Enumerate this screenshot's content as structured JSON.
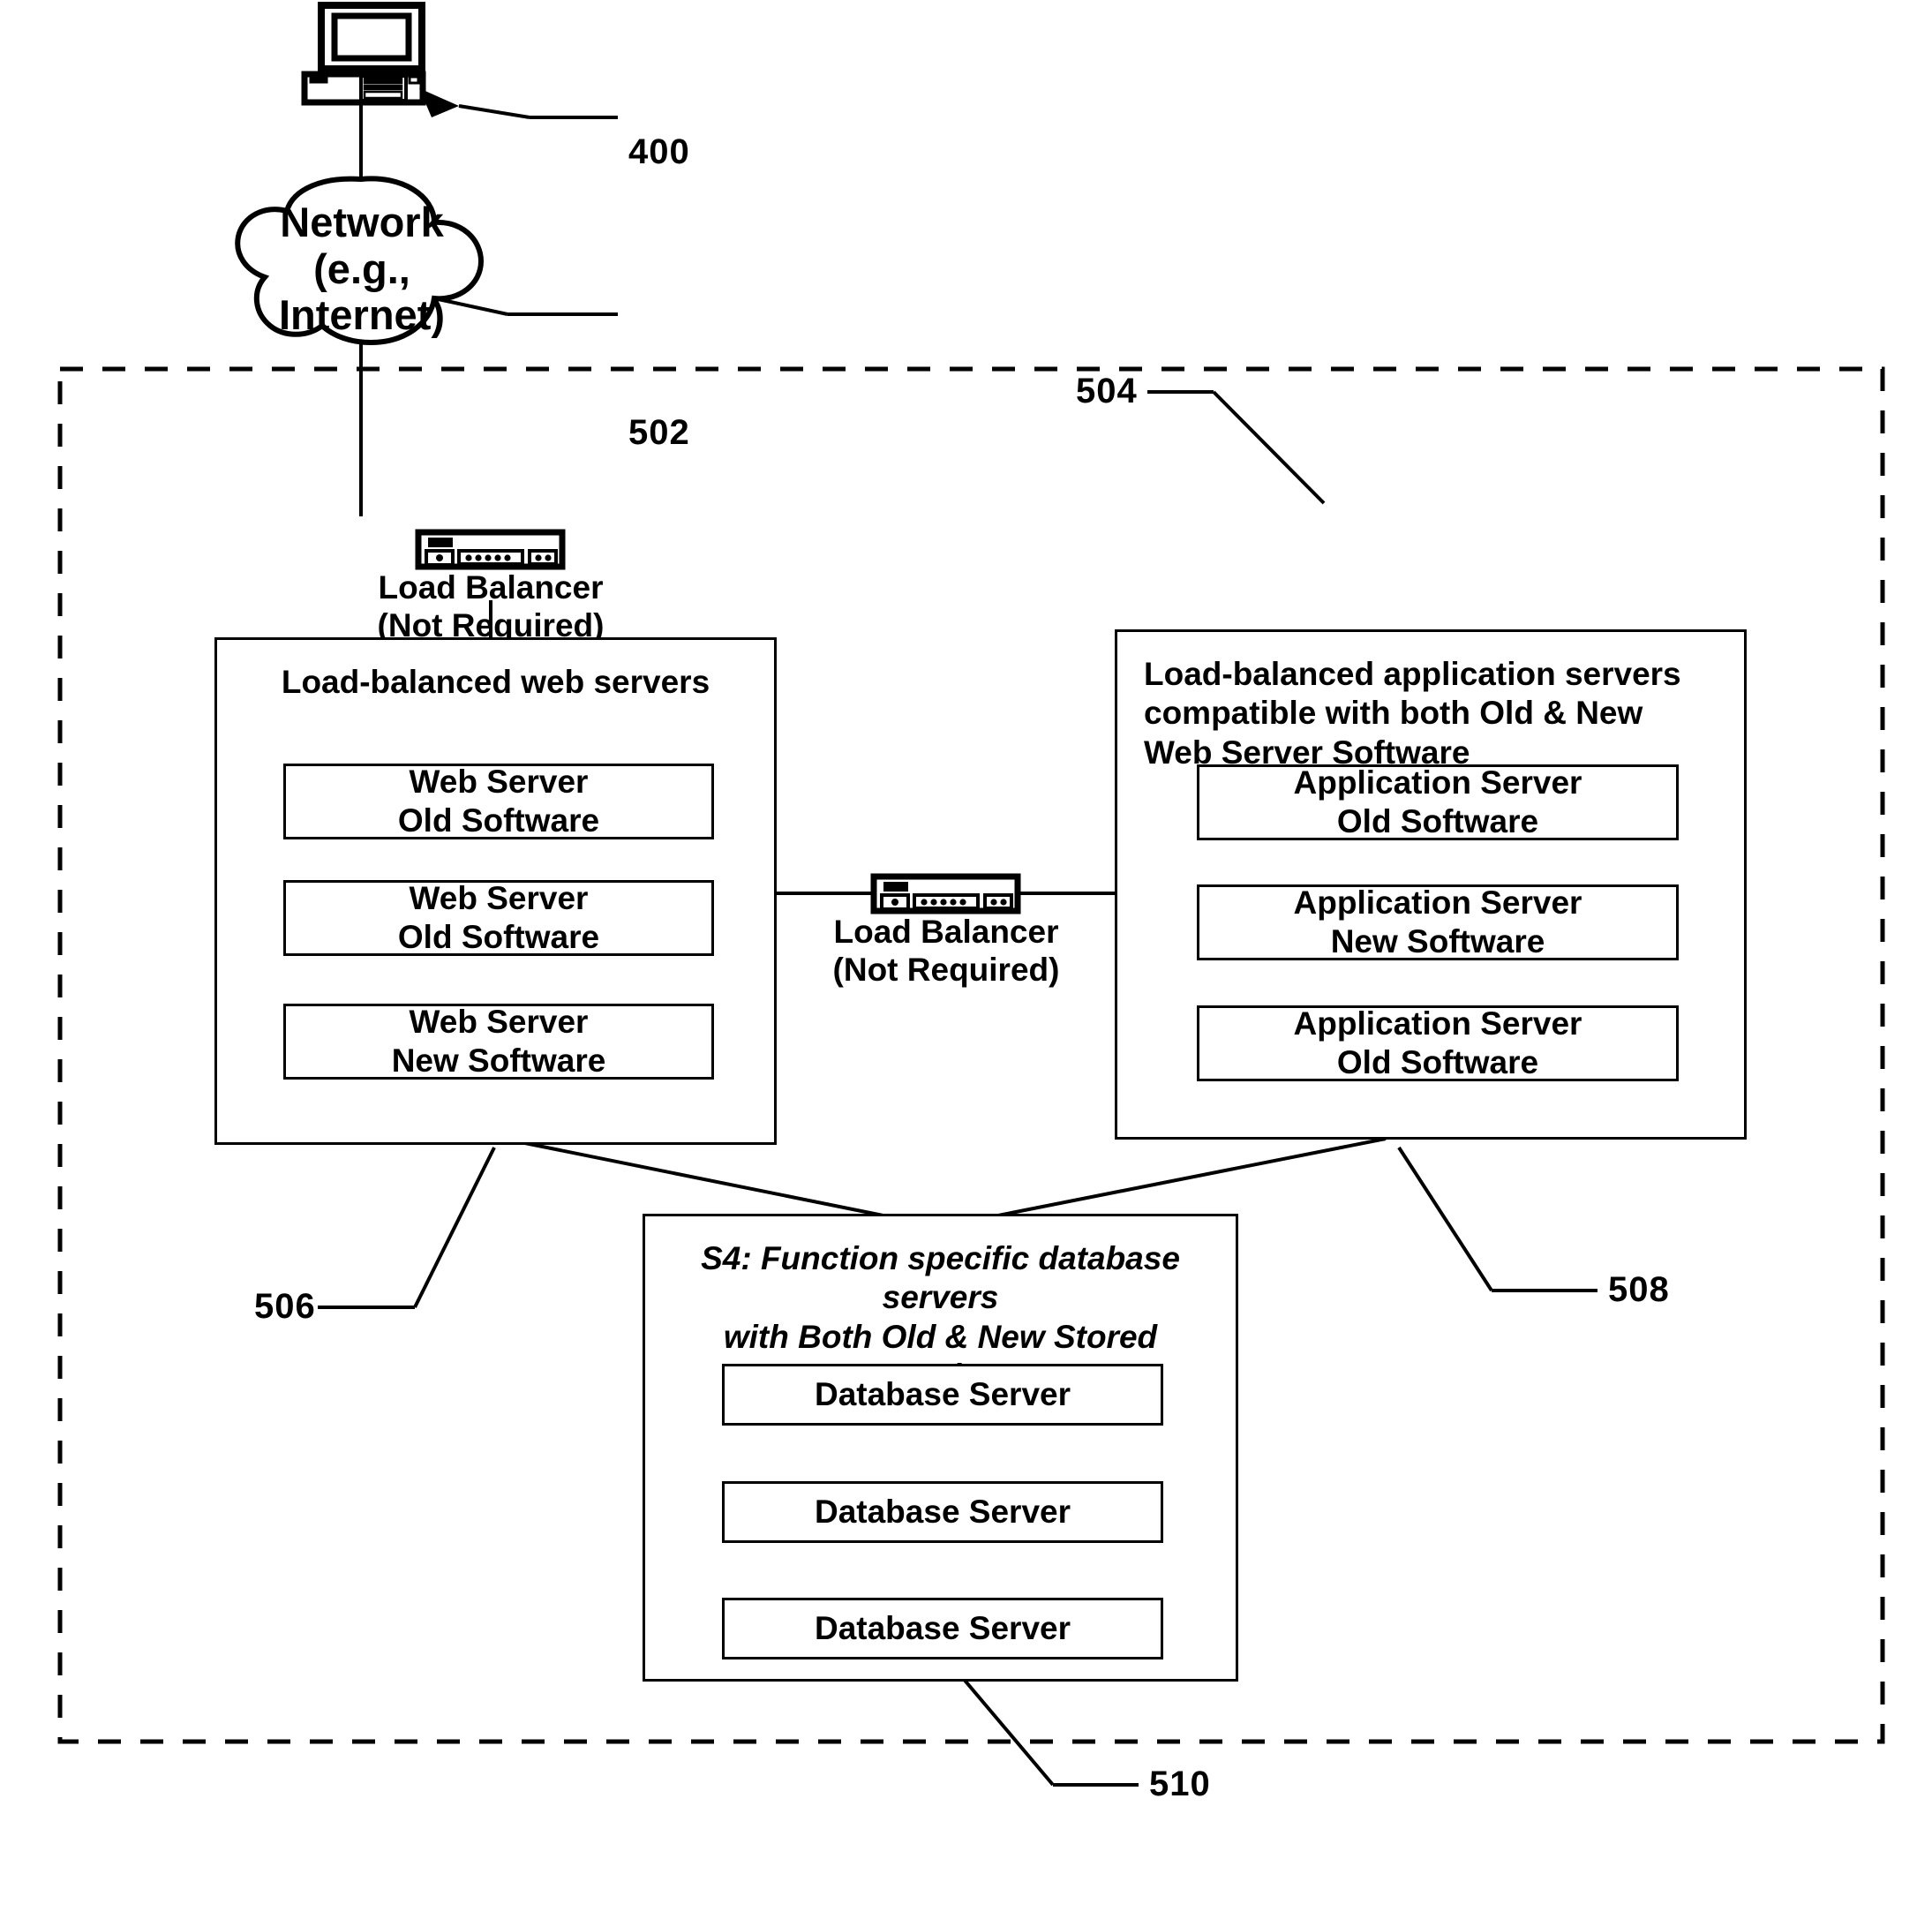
{
  "figure": {
    "client": {
      "ref": "400",
      "icon": "desktop-computer-icon"
    },
    "network_cloud": {
      "ref": "502",
      "lines": [
        "Network",
        "(e.g.,",
        "Internet)"
      ]
    },
    "system_boundary": {
      "ref": "504",
      "style": "dashed"
    },
    "top_load_balancer": {
      "icon": "load-balancer-icon",
      "lines": [
        "Load Balancer",
        "(Not Required)"
      ]
    },
    "middle_load_balancer": {
      "icon": "load-balancer-icon",
      "lines": [
        "Load Balancer",
        "(Not Required)"
      ]
    },
    "web_tier": {
      "ref": "506",
      "title": "Load-balanced web servers",
      "servers": [
        {
          "line1": "Web Server",
          "line2": "Old Software"
        },
        {
          "line1": "Web Server",
          "line2": "Old Software"
        },
        {
          "line1": "Web Server",
          "line2": "New Software"
        }
      ]
    },
    "app_tier": {
      "ref": "508",
      "title": "Load-balanced application servers compatible with both Old & New Web Server Software",
      "servers": [
        {
          "line1": "Application Server",
          "line2": "Old Software"
        },
        {
          "line1": "Application Server",
          "line2": "New Software"
        },
        {
          "line1": "Application Server",
          "line2": "Old Software"
        }
      ]
    },
    "db_tier": {
      "ref": "510",
      "title_line1": "S4: Function specific database servers",
      "title_line2": "with Both Old & New Stored Procedures",
      "servers": [
        {
          "line1": "Database Server"
        },
        {
          "line1": "Database Server"
        },
        {
          "line1": "Database Server"
        }
      ]
    }
  }
}
